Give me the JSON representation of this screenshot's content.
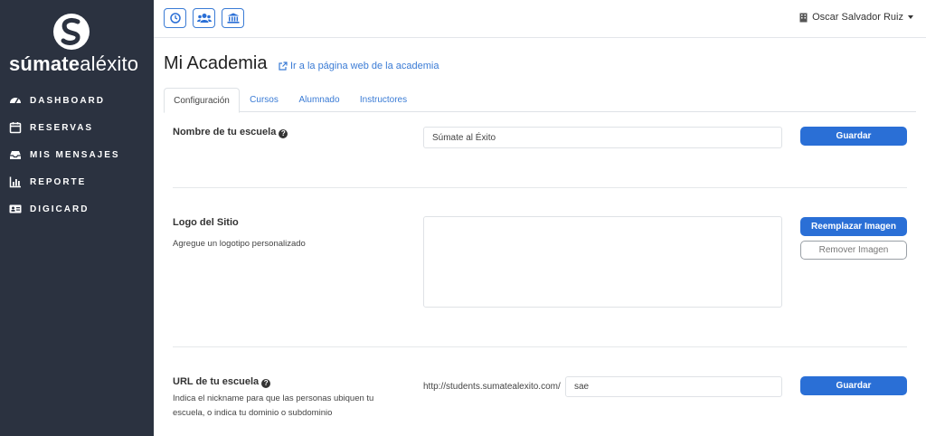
{
  "sidebar": {
    "brand_bold": "súmate",
    "brand_light": "aléxito",
    "items": [
      {
        "label": "DASHBOARD",
        "icon": "dashboard-icon"
      },
      {
        "label": "RESERVAS",
        "icon": "calendar-icon"
      },
      {
        "label": "MIS MENSAJES",
        "icon": "inbox-icon"
      },
      {
        "label": "REPORTE",
        "icon": "chart-icon"
      },
      {
        "label": "DIGICARD",
        "icon": "id-card-icon"
      }
    ]
  },
  "topbar": {
    "buttons": [
      "clock-icon",
      "users-icon",
      "institution-icon"
    ],
    "user_name": "Oscar Salvador Ruiz"
  },
  "page": {
    "title": "Mi Academia",
    "external_link": "Ir a la página web de la academia"
  },
  "tabs": [
    {
      "label": "Configuración",
      "active": true
    },
    {
      "label": "Cursos",
      "active": false
    },
    {
      "label": "Alumnado",
      "active": false
    },
    {
      "label": "Instructores",
      "active": false
    }
  ],
  "school_name": {
    "label": "Nombre de tu escuela",
    "value": "Súmate al Éxito",
    "save_label": "Guardar"
  },
  "site_logo": {
    "label": "Logo del Sitio",
    "description": "Agregue un logotipo personalizado",
    "replace_label": "Reemplazar Imagen",
    "remove_label": "Remover Imagen"
  },
  "school_url": {
    "label": "URL de tu escuela",
    "description_line1": "Indica el nickname para que las personas ubiquen tu",
    "description_line2": "escuela, o indica tu dominio o subdominio",
    "prefix": "http://students.sumatealexito.com/",
    "value": "sae",
    "save_label": "Guardar"
  },
  "colors": {
    "sidebar_bg": "#2b3240",
    "primary": "#2a6fd6",
    "link": "#3a7bd5"
  }
}
